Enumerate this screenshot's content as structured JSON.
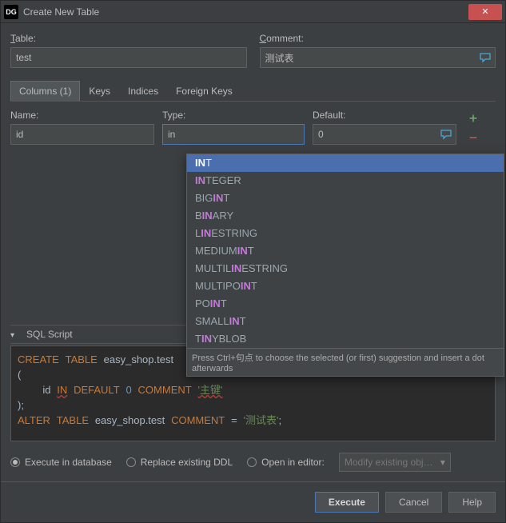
{
  "window": {
    "title": "Create New Table",
    "logo": "DG"
  },
  "labels": {
    "table": "Table:",
    "comment": "Comment:",
    "name": "Name:",
    "type": "Type:",
    "default": "Default:",
    "sql_script": "SQL Script"
  },
  "fields": {
    "table": "test",
    "comment": "测试表",
    "col_name": "id",
    "col_type": "in",
    "col_default": "0"
  },
  "tabs": [
    {
      "label": "Columns (1)",
      "active": true
    },
    {
      "label": "Keys",
      "active": false
    },
    {
      "label": "Indices",
      "active": false
    },
    {
      "label": "Foreign Keys",
      "active": false
    }
  ],
  "autocomplete": {
    "items": [
      {
        "text": "INT",
        "hi": [
          0,
          1
        ]
      },
      {
        "text": "INTEGER",
        "hi": [
          0,
          1
        ]
      },
      {
        "text": "BIGINT",
        "hi": [
          3,
          4
        ]
      },
      {
        "text": "BINARY",
        "hi": [
          1,
          2
        ]
      },
      {
        "text": "LINESTRING",
        "hi": [
          1,
          2
        ]
      },
      {
        "text": "MEDIUMINT",
        "hi": [
          6,
          7
        ]
      },
      {
        "text": "MULTILINESTRING",
        "hi": [
          6,
          7
        ]
      },
      {
        "text": "MULTIPOINT",
        "hi": [
          7,
          8
        ]
      },
      {
        "text": "POINT",
        "hi": [
          2,
          3
        ]
      },
      {
        "text": "SMALLINT",
        "hi": [
          5,
          6
        ]
      },
      {
        "text": "TINYBLOB",
        "hi": [
          1,
          2
        ]
      }
    ],
    "hint": "Press Ctrl+句点 to choose the selected (or first) suggestion and insert a dot afterwards"
  },
  "sql": {
    "schema": "easy_shop",
    "table": "test",
    "col": "id",
    "type_token": "IN",
    "default_val": "0",
    "col_comment": "主键",
    "table_comment": "测试表"
  },
  "bottom": {
    "opt1": "Execute in database",
    "opt2": "Replace existing DDL",
    "opt3": "Open in editor:",
    "dropdown": "Modify existing obj…"
  },
  "buttons": {
    "execute": "Execute",
    "cancel": "Cancel",
    "help": "Help"
  }
}
